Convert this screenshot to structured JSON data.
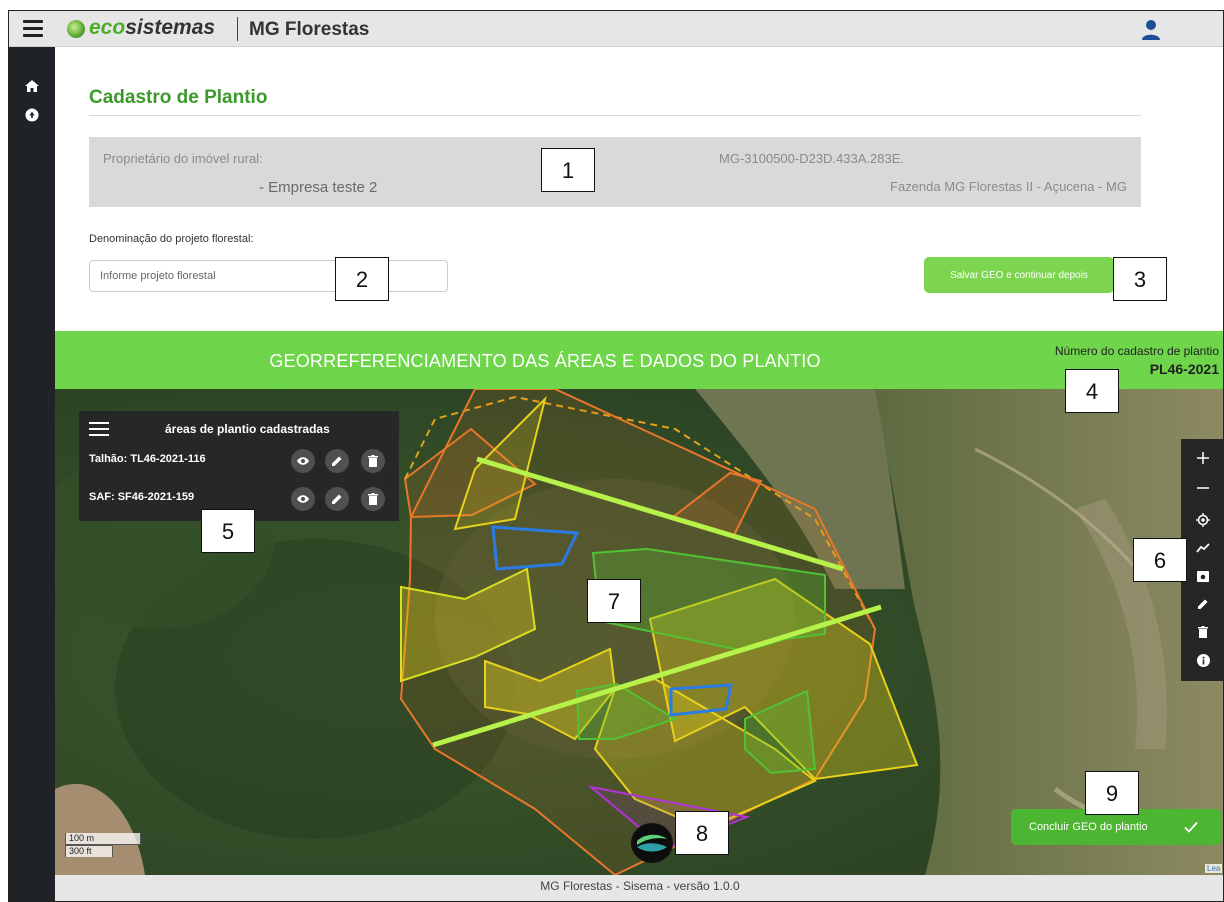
{
  "header": {
    "logo_eco": "eco",
    "logo_rest": "sistemas",
    "app_name": "MG Florestas"
  },
  "page": {
    "title": "Cadastro de Plantio"
  },
  "owner": {
    "label": "Proprietário do imóvel rural:",
    "name": "- Empresa teste 2",
    "car_code": "MG-3100500-D23D.433A.283E.",
    "farm": "Fazenda MG Florestas II - Açucena - MG"
  },
  "project": {
    "label": "Denominação do projeto florestal:",
    "placeholder": "Informe projeto florestal",
    "value": ""
  },
  "actions": {
    "save_label": "Salvar GEO e continuar depois",
    "conclude_label": "Concluir GEO do plantio"
  },
  "band": {
    "title": "GEORREFERENCIAMENTO DAS ÁREAS E DADOS DO PLANTIO",
    "reg_label": "Número do cadastro de plantio",
    "reg_value": "PL46-2021"
  },
  "layers_panel": {
    "title": "áreas de plantio cadastradas",
    "items": [
      {
        "label": "Talhão: TL46-2021-116"
      },
      {
        "label": "SAF: SF46-2021-159"
      }
    ]
  },
  "map": {
    "scale_m": "100 m",
    "scale_ft": "300 ft",
    "attribution": "Lea",
    "toolbar_icons": [
      "zoom-in-icon",
      "zoom-out-icon",
      "locate-icon",
      "draw-polyline-icon",
      "draw-rectangle-icon",
      "edit-icon",
      "delete-icon",
      "info-icon"
    ]
  },
  "callouts": [
    "1",
    "2",
    "3",
    "4",
    "5",
    "6",
    "7",
    "8",
    "9"
  ],
  "footer": {
    "text": "MG Florestas - Sisema - versão 1.0.0"
  },
  "colors": {
    "accent_green": "#6fd54a",
    "title_green": "#3c9a2c",
    "save_button": "#7dd54f",
    "conclude_button": "#4cb632",
    "sidebar": "#1f2327",
    "polygon_orange": "#e8762b",
    "polygon_yellow": "#e6d21b",
    "polygon_green": "#52c234",
    "polygon_blue": "#2a7be4",
    "polygon_purple": "#b234d8"
  }
}
